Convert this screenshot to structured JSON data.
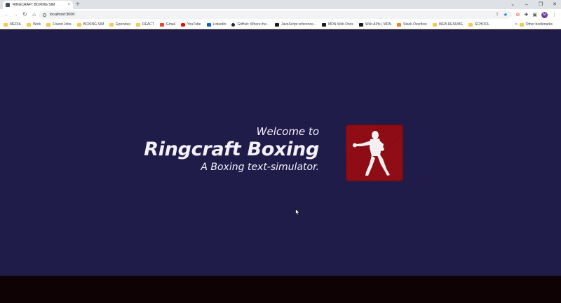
{
  "browser": {
    "tab": {
      "title": "RINGCRAFT BOXING SIM",
      "close": "×"
    },
    "new_tab": "+",
    "window_controls": [
      "⌄",
      "–",
      "❐",
      "✕"
    ],
    "url": "localhost:3000",
    "bookmarks": [
      {
        "label": "MEDIA",
        "icon": "folder"
      },
      {
        "label": "Work",
        "icon": "folder"
      },
      {
        "label": "Found Jobs",
        "icon": "folder"
      },
      {
        "label": "BOXING SIM",
        "icon": "folder"
      },
      {
        "label": "Epicodus",
        "icon": "folder"
      },
      {
        "label": "REACT",
        "icon": "folder"
      },
      {
        "label": "Gmail",
        "icon": "gmail"
      },
      {
        "label": "YouTube",
        "icon": "youtube"
      },
      {
        "label": "LinkedIn",
        "icon": "linkedin"
      },
      {
        "label": "GitHub: Where the...",
        "icon": "github"
      },
      {
        "label": "JavaScript reference...",
        "icon": "dark"
      },
      {
        "label": "MDN Web Docs",
        "icon": "dark"
      },
      {
        "label": "Web APIs | MDN",
        "icon": "dark"
      },
      {
        "label": "Stack Overflow",
        "icon": "so"
      },
      {
        "label": "WEB RESUME",
        "icon": "folder"
      },
      {
        "label": "SCHOOL",
        "icon": "folder"
      }
    ],
    "bookmarks_more": "»",
    "other_bookmarks": "Other bookmarks",
    "avatar_initial": "M"
  },
  "page": {
    "welcome": "Welcome to",
    "title": "Ringcraft Boxing",
    "tagline": "A Boxing text-simulator."
  },
  "colors": {
    "page_bg": "#201c4a",
    "footer_bg": "#0e0205",
    "logo_red": "#9e0f17",
    "text": "#f3f0f8"
  },
  "icons": {
    "back": "arrow-left-icon",
    "forward": "arrow-right-icon",
    "reload": "reload-icon",
    "home": "home-icon",
    "share": "share-icon",
    "bookmark_star": "star-icon",
    "extensions": "puzzle-icon",
    "sidepanel": "sidepanel-icon",
    "menu": "kebab-menu-icon",
    "logo": "boxer-silhouette-icon"
  }
}
